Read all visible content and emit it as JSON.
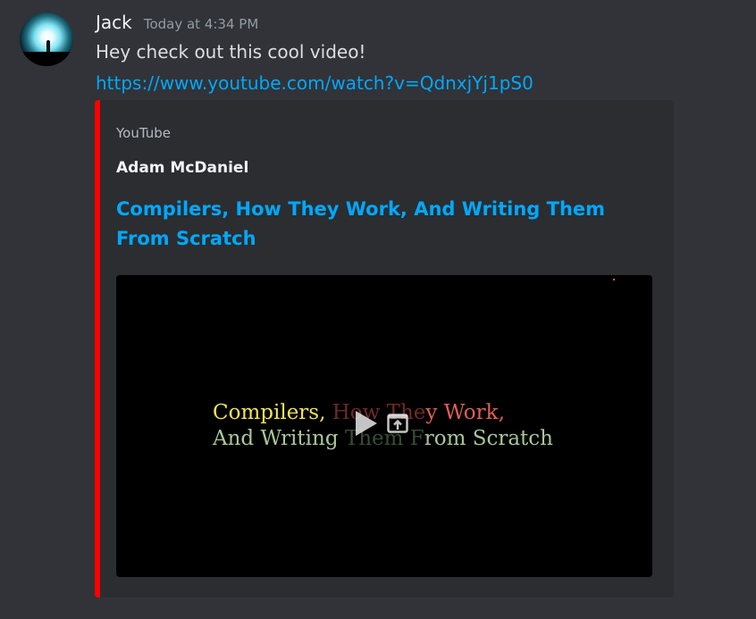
{
  "message": {
    "username": "Jack",
    "timestamp": "Today at 4:34 PM",
    "text": "Hey check out this cool video!",
    "link": "https://www.youtube.com/watch?v=QdnxjYj1pS0"
  },
  "embed": {
    "provider": "YouTube",
    "author": "Adam McDaniel",
    "title": "Compilers, How They Work, And Writing Them From Scratch",
    "accent_color": "#ff0000",
    "thumbnail": {
      "line1": {
        "part1": "Compilers, ",
        "part2": "How The",
        "part3": "y Work",
        "part4": ","
      },
      "line2": {
        "part1": "And Writing ",
        "part2": "Them F",
        "part3": "rom Scratch"
      }
    },
    "play_icon": "play-icon",
    "popout_icon": "popout-icon"
  }
}
